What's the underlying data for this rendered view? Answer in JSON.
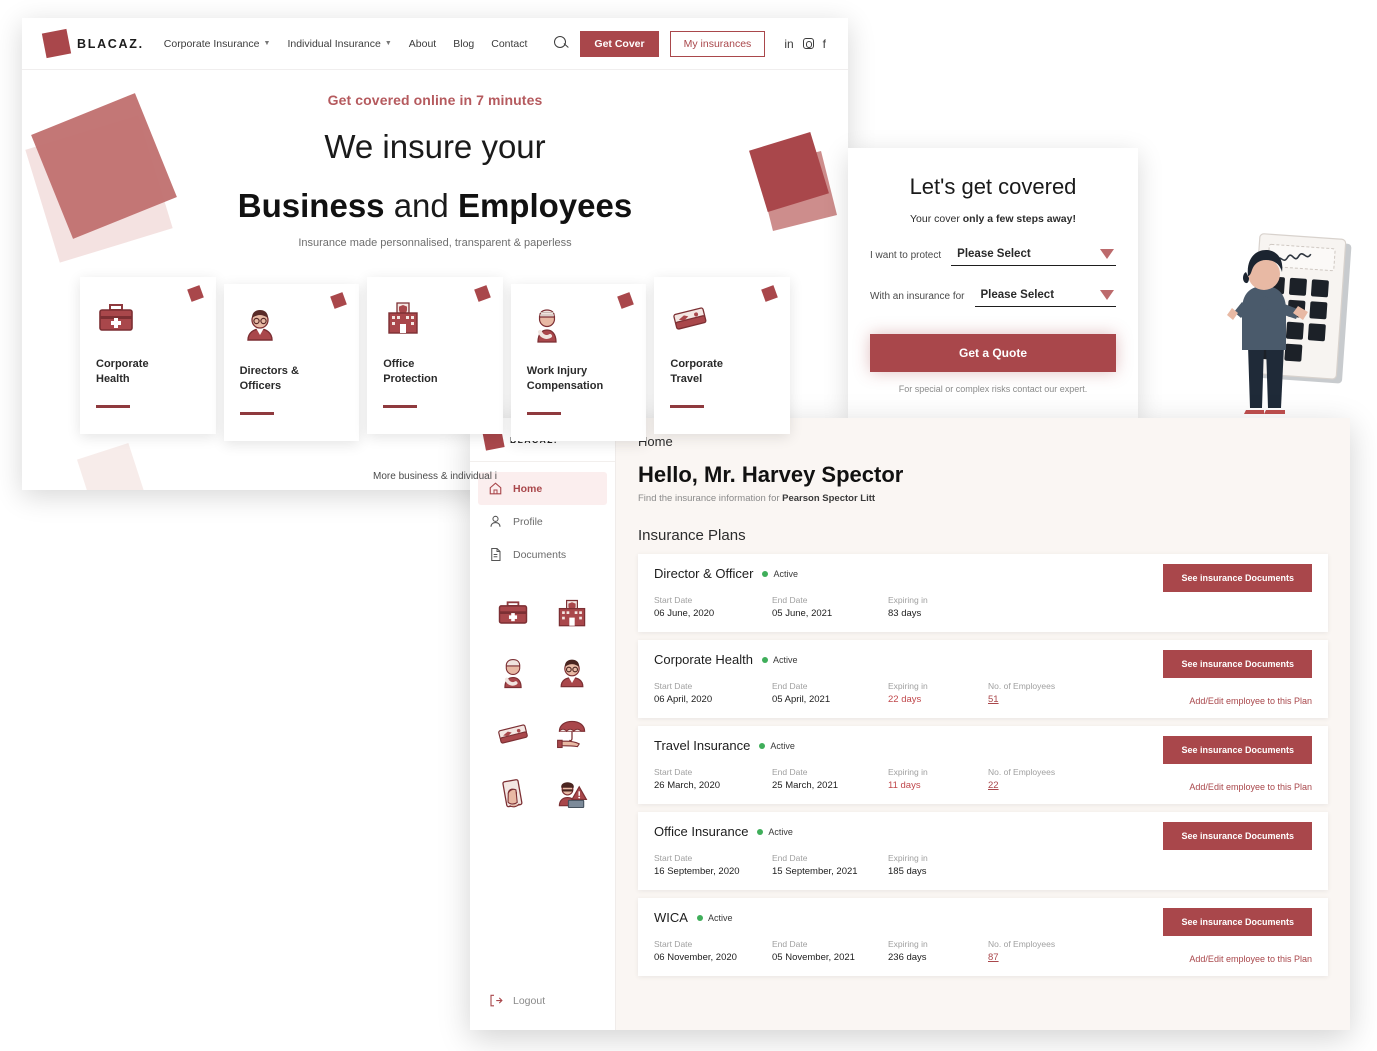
{
  "site": {
    "navbar": {
      "brand": "BLACAZ.",
      "links": [
        {
          "label": "Corporate Insurance",
          "has_dropdown": true
        },
        {
          "label": "Individual Insurance",
          "has_dropdown": true
        },
        {
          "label": "About",
          "has_dropdown": false
        },
        {
          "label": "Blog",
          "has_dropdown": false
        },
        {
          "label": "Contact",
          "has_dropdown": false
        }
      ],
      "get_cover_label": "Get Cover",
      "my_insurances_label": "My insurances",
      "socials": [
        "linkedin-icon",
        "instagram-icon",
        "facebook-icon"
      ]
    },
    "hero": {
      "eyebrow": "Get covered online in 7 minutes",
      "headline_line1": "We insure your",
      "headline_line2_strong1": "Business",
      "headline_line2_mid": " and ",
      "headline_line2_strong2": "Employees",
      "subtitle": "Insurance made personnalised, transparent & paperless"
    },
    "product_cards": [
      {
        "title": "Corporate\nHealth",
        "icon": "first-aid-kit-icon"
      },
      {
        "title": "Directors &\nOfficers",
        "icon": "businessman-icon"
      },
      {
        "title": "Office\nProtection",
        "icon": "office-building-icon"
      },
      {
        "title": "Work Injury\nCompensation",
        "icon": "injured-worker-icon"
      },
      {
        "title": "Corporate\nTravel",
        "icon": "travel-tickets-icon"
      }
    ],
    "more_line": "More business & individual i",
    "accent_color": "#a9474b"
  },
  "quote_panel": {
    "title": "Let's get covered",
    "subtitle_pre": "Your cover ",
    "subtitle_strong": "only a few steps away!",
    "fields": [
      {
        "label": "I want to protect",
        "value": "Please Select"
      },
      {
        "label": "With an insurance for",
        "value": "Please Select"
      }
    ],
    "cta_label": "Get a Quote",
    "footnote": "For special or complex risks contact our expert."
  },
  "dashboard": {
    "brand": "BLACAZ.",
    "sidebar": {
      "items": [
        {
          "label": "Home",
          "icon": "home-icon",
          "active": true
        },
        {
          "label": "Profile",
          "icon": "user-icon",
          "active": false
        },
        {
          "label": "Documents",
          "icon": "document-icon",
          "active": false
        }
      ],
      "product_icons": [
        "first-aid-kit-icon",
        "office-building-icon",
        "injured-worker-icon",
        "businessman-icon",
        "travel-tickets-icon",
        "umbrella-hand-icon",
        "money-hand-icon",
        "cyber-risk-icon"
      ],
      "logout_label": "Logout"
    },
    "breadcrumb": "Home",
    "greeting": "Hello, Mr. Harvey Spector",
    "subtitle_pre": "Find the insurance information for ",
    "company": "Pearson Spector Litt",
    "section_title": "Insurance Plans",
    "labels": {
      "start_date": "Start Date",
      "end_date": "End Date",
      "expiring_in": "Expiring in",
      "no_employees": "No. of Employees",
      "see_documents": "See insurance Documents",
      "add_edit": "Add/Edit employee to this Plan",
      "status": "Active"
    },
    "plans": [
      {
        "name": "Director & Officer",
        "status": "Active",
        "start_date": "06 June, 2020",
        "end_date": "05 June, 2021",
        "expiring_in": "83 days",
        "expiring_urgent": false,
        "employees": null
      },
      {
        "name": "Corporate Health",
        "status": "Active",
        "start_date": "06 April, 2020",
        "end_date": "05 April, 2021",
        "expiring_in": "22 days",
        "expiring_urgent": true,
        "employees": "51"
      },
      {
        "name": "Travel Insurance",
        "status": "Active",
        "start_date": "26 March, 2020",
        "end_date": "25 March, 2021",
        "expiring_in": "11 days",
        "expiring_urgent": true,
        "employees": "22"
      },
      {
        "name": "Office Insurance",
        "status": "Active",
        "start_date": "16 September, 2020",
        "end_date": "15 September, 2021",
        "expiring_in": "185 days",
        "expiring_urgent": false,
        "employees": null
      },
      {
        "name": "WICA",
        "status": "Active",
        "start_date": "06 November, 2020",
        "end_date": "05 November, 2021",
        "expiring_in": "236 days",
        "expiring_urgent": false,
        "employees": "87"
      }
    ]
  }
}
